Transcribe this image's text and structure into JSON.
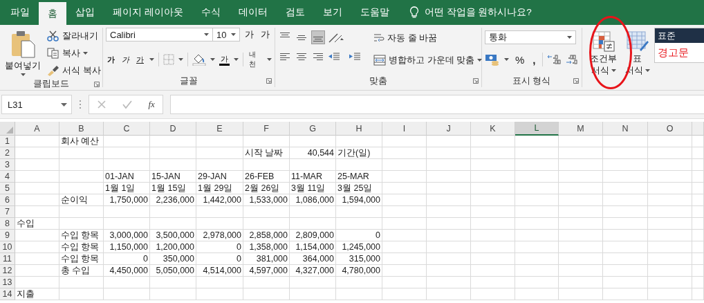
{
  "tabs": [
    {
      "label": "파일",
      "selected": false
    },
    {
      "label": "홈",
      "selected": true
    },
    {
      "label": "삽입",
      "selected": false
    },
    {
      "label": "페이지 레이아웃",
      "selected": false
    },
    {
      "label": "수식",
      "selected": false
    },
    {
      "label": "데이터",
      "selected": false
    },
    {
      "label": "검토",
      "selected": false
    },
    {
      "label": "보기",
      "selected": false
    },
    {
      "label": "도움말",
      "selected": false
    }
  ],
  "tell_me": {
    "placeholder": "어떤 작업을 원하시나요?"
  },
  "ribbon": {
    "clipboard": {
      "label": "클립보드",
      "paste": "붙여넣기",
      "cut": "잘라내기",
      "copy": "복사",
      "format_painter": "서식 복사"
    },
    "font": {
      "label": "글꼴",
      "font_name": "Calibri",
      "font_size": "10",
      "grow": "가",
      "shrink": "가",
      "bold": "가",
      "italic": "가",
      "underline": "가",
      "font_color": "가",
      "phonetic": "내천"
    },
    "alignment": {
      "label": "맞춤",
      "wrap_text": "자동 줄 바꿈",
      "merge_center": "병합하고 가운데 맞춤",
      "align_buttons": [
        {
          "kind": "top",
          "selected": false
        },
        {
          "kind": "middle",
          "selected": false
        },
        {
          "kind": "bottom",
          "selected": true
        },
        {
          "kind": "left",
          "selected": false
        },
        {
          "kind": "center",
          "selected": false
        },
        {
          "kind": "right",
          "selected": false
        }
      ]
    },
    "number": {
      "label": "표시 형식",
      "format": "통화",
      "percent": "%",
      "comma": ","
    },
    "styles": {
      "conditional": {
        "lines": [
          "조건부",
          "서식"
        ],
        "circled": true
      },
      "table": {
        "lines": [
          "표",
          "서식"
        ]
      },
      "gallery": [
        {
          "label": "표준",
          "kind": "normal",
          "selected": true
        },
        {
          "label": "경고문",
          "kind": "warning",
          "selected": false
        }
      ]
    }
  },
  "formula_bar": {
    "name_box": "L31",
    "fx": "fx"
  },
  "grid": {
    "columns": [
      {
        "label": "A",
        "selected": false
      },
      {
        "label": "B",
        "selected": false
      },
      {
        "label": "C",
        "selected": false
      },
      {
        "label": "D",
        "selected": false
      },
      {
        "label": "E",
        "selected": false
      },
      {
        "label": "F",
        "selected": false
      },
      {
        "label": "G",
        "selected": false
      },
      {
        "label": "H",
        "selected": false
      },
      {
        "label": "I",
        "selected": false
      },
      {
        "label": "J",
        "selected": false
      },
      {
        "label": "K",
        "selected": false
      },
      {
        "label": "L",
        "selected": true
      },
      {
        "label": "M",
        "selected": false
      },
      {
        "label": "N",
        "selected": false
      },
      {
        "label": "O",
        "selected": false
      }
    ],
    "rows": [
      {
        "number": "1",
        "cells": [
          "",
          {
            "text": "회사 예산",
            "kind": "text"
          }
        ]
      },
      {
        "number": "2",
        "cells": [
          "",
          "",
          "",
          "",
          "",
          {
            "text": "시작 날짜",
            "kind": "text"
          },
          {
            "text": "40,544",
            "kind": "number"
          },
          {
            "text": "기간(일)",
            "kind": "text"
          }
        ]
      },
      {
        "number": "3",
        "cells": []
      },
      {
        "number": "4",
        "cells": [
          "",
          "",
          {
            "text": "01-JAN",
            "kind": "text"
          },
          {
            "text": "15-JAN",
            "kind": "text"
          },
          {
            "text": "29-JAN",
            "kind": "text"
          },
          {
            "text": "26-FEB",
            "kind": "text"
          },
          {
            "text": "11-MAR",
            "kind": "text"
          },
          {
            "text": "25-MAR",
            "kind": "text"
          }
        ]
      },
      {
        "number": "5",
        "cells": [
          "",
          "",
          {
            "text": "1월 1일",
            "kind": "text"
          },
          {
            "text": "1월 15일",
            "kind": "text"
          },
          {
            "text": "1월 29일",
            "kind": "text"
          },
          {
            "text": "2월 26일",
            "kind": "text"
          },
          {
            "text": "3월 11일",
            "kind": "text"
          },
          {
            "text": "3월 25일",
            "kind": "text"
          }
        ]
      },
      {
        "number": "6",
        "cells": [
          "",
          {
            "text": "순이익",
            "kind": "text"
          },
          {
            "text": "1,750,000",
            "kind": "number"
          },
          {
            "text": "2,236,000",
            "kind": "number"
          },
          {
            "text": "1,442,000",
            "kind": "number"
          },
          {
            "text": "1,533,000",
            "kind": "number"
          },
          {
            "text": "1,086,000",
            "kind": "number"
          },
          {
            "text": "1,594,000",
            "kind": "number"
          }
        ]
      },
      {
        "number": "7",
        "cells": []
      },
      {
        "number": "8",
        "cells": [
          {
            "text": "수입",
            "kind": "text"
          }
        ]
      },
      {
        "number": "9",
        "cells": [
          "",
          {
            "text": "수입 항목",
            "kind": "text"
          },
          {
            "text": "3,000,000",
            "kind": "number"
          },
          {
            "text": "3,500,000",
            "kind": "number"
          },
          {
            "text": "2,978,000",
            "kind": "number"
          },
          {
            "text": "2,858,000",
            "kind": "number"
          },
          {
            "text": "2,809,000",
            "kind": "number"
          },
          {
            "text": "0",
            "kind": "number"
          }
        ]
      },
      {
        "number": "10",
        "cells": [
          "",
          {
            "text": "수입 항목",
            "kind": "text"
          },
          {
            "text": "1,150,000",
            "kind": "number"
          },
          {
            "text": "1,200,000",
            "kind": "number"
          },
          {
            "text": "0",
            "kind": "number"
          },
          {
            "text": "1,358,000",
            "kind": "number"
          },
          {
            "text": "1,154,000",
            "kind": "number"
          },
          {
            "text": "1,245,000",
            "kind": "number"
          }
        ]
      },
      {
        "number": "11",
        "cells": [
          "",
          {
            "text": "수입 항목",
            "kind": "text"
          },
          {
            "text": "0",
            "kind": "number"
          },
          {
            "text": "350,000",
            "kind": "number"
          },
          {
            "text": "0",
            "kind": "number"
          },
          {
            "text": "381,000",
            "kind": "number"
          },
          {
            "text": "364,000",
            "kind": "number"
          },
          {
            "text": "315,000",
            "kind": "number"
          }
        ]
      },
      {
        "number": "12",
        "cells": [
          "",
          {
            "text": "총 수입",
            "kind": "text"
          },
          {
            "text": "4,450,000",
            "kind": "number"
          },
          {
            "text": "5,050,000",
            "kind": "number"
          },
          {
            "text": "4,514,000",
            "kind": "number"
          },
          {
            "text": "4,597,000",
            "kind": "number"
          },
          {
            "text": "4,327,000",
            "kind": "number"
          },
          {
            "text": "4,780,000",
            "kind": "number"
          }
        ]
      },
      {
        "number": "13",
        "cells": []
      },
      {
        "number": "14",
        "cells": [
          {
            "text": "지출",
            "kind": "text"
          }
        ]
      }
    ]
  }
}
